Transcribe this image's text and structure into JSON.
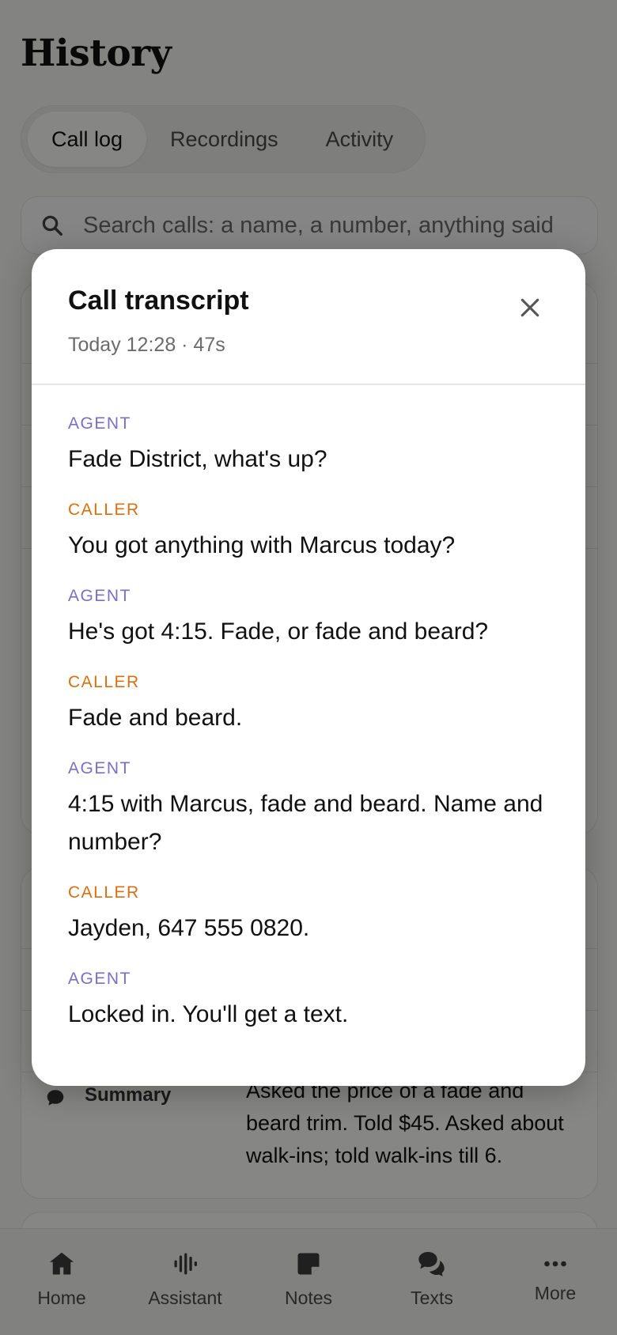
{
  "page": {
    "title": "History",
    "tabs": [
      {
        "label": "Call log",
        "active": true
      },
      {
        "label": "Recordings",
        "active": false
      },
      {
        "label": "Activity",
        "active": false
      }
    ],
    "search_placeholder": "Search calls: a name, a number, anything said"
  },
  "summary": {
    "label": "Summary",
    "text": "Asked the price of a fade and beard trim. Told $45. Asked about walk-ins; told walk-ins till 6."
  },
  "nav": {
    "items": [
      {
        "label": "Home",
        "icon": "home-icon"
      },
      {
        "label": "Assistant",
        "icon": "waveform-icon"
      },
      {
        "label": "Notes",
        "icon": "note-icon"
      },
      {
        "label": "Texts",
        "icon": "chat-bubbles-icon"
      },
      {
        "label": "More",
        "icon": "more-dots-icon"
      }
    ]
  },
  "modal": {
    "title": "Call transcript",
    "subtitle": "Today 12:28 · 47s",
    "turns": [
      {
        "speaker": "AGENT",
        "role": "agent",
        "text": "Fade District, what's up?"
      },
      {
        "speaker": "CALLER",
        "role": "caller",
        "text": "You got anything with Marcus today?"
      },
      {
        "speaker": "AGENT",
        "role": "agent",
        "text": "He's got 4:15. Fade, or fade and beard?"
      },
      {
        "speaker": "CALLER",
        "role": "caller",
        "text": "Fade and beard."
      },
      {
        "speaker": "AGENT",
        "role": "agent",
        "text": "4:15 with Marcus, fade and beard. Name and number?"
      },
      {
        "speaker": "CALLER",
        "role": "caller",
        "text": "Jayden, 647 555 0820."
      },
      {
        "speaker": "AGENT",
        "role": "agent",
        "text": "Locked in. You'll get a text."
      }
    ]
  },
  "colors": {
    "agent": "#7a6fc4",
    "caller": "#d86f12",
    "scrim": "rgba(0,0,0,0.47)"
  }
}
